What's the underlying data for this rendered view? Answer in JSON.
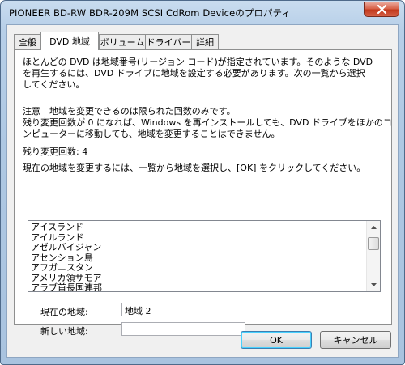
{
  "window": {
    "title": "PIONEER BD-RW   BDR-209M SCSI CdRom Deviceのプロパティ"
  },
  "tabs": [
    {
      "label": "全般"
    },
    {
      "label": "DVD 地域",
      "active": true
    },
    {
      "label": "ボリューム"
    },
    {
      "label": "ドライバー"
    },
    {
      "label": "詳細"
    }
  ],
  "dvd_region": {
    "intro_lines": [
      "ほとんどの DVD は地域番号(リージョン コード)が指定されています。そのような DVD",
      "を再生するには、DVD ドライブに地域を設定する必要があります。次の一覧から選択",
      "してください。"
    ],
    "note_lines": [
      "注意　地域を変更できるのは限られた回数のみです。",
      "残り変更回数が 0 になれば、Windows を再インストールしても、DVD ドライブをほかのコ",
      "ンピューターに移動しても、地域を変更することはできません。"
    ],
    "remaining_label": "残り変更回数: 4",
    "instruction": "現在の地域を変更するには、一覧から地域を選択し、[OK] をクリックしてください。",
    "regions": [
      "アイスランド",
      "アイルランド",
      "アゼルバイジャン",
      "アセンション島",
      "アフガニスタン",
      "アメリカ領サモア",
      "アラブ首長国連邦"
    ],
    "current_region_label": "現在の地域:",
    "current_region_value": "地域 2",
    "new_region_label": "新しい地域:",
    "new_region_value": ""
  },
  "buttons": {
    "ok": "OK",
    "cancel": "キャンセル"
  },
  "icons": {
    "close": "close-icon",
    "scroll_up": "scroll-up-arrow-icon",
    "scroll_down": "scroll-down-arrow-icon"
  },
  "colors": {
    "title_bar": "#b7cfe8",
    "close_button": "#c2391c",
    "default_button_border": "#3c7fb1"
  }
}
